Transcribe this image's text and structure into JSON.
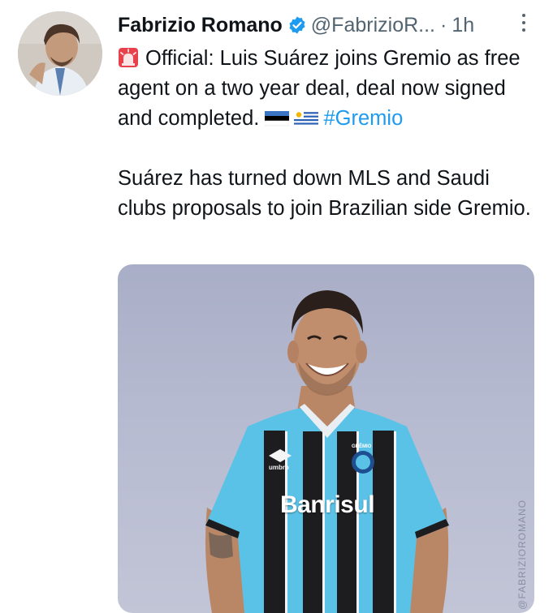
{
  "tweet": {
    "author_name": "Fabrizio Romano",
    "handle": "@FabrizioR...",
    "separator": "·",
    "time": "1h",
    "line1_text": "Official: Luis Suárez joins Gremio as free agent on a two year deal, deal now signed and completed.",
    "hashtag": "#Gremio",
    "line2_text": "Suárez has turned down MLS and Saudi clubs proposals to join Brazilian side Gremio."
  },
  "media": {
    "shirt_sponsor": "Banrisul",
    "watermark": "@FABRIZIOROMANO",
    "kit_brand": "umbro",
    "crest_text": "GRÊMIO"
  },
  "icons": {
    "verified": "verified-badge-icon",
    "more": "more-options-icon",
    "siren": "rotating-light-emoji",
    "flag1": "estonia-flag-emoji",
    "flag2": "uruguay-flag-emoji"
  },
  "colors": {
    "link": "#1d9bf0",
    "muted": "#536471",
    "text": "#0f1419",
    "verified": "#1d9bf0",
    "kit_sky_blue": "#5bc2e7",
    "kit_black": "#1d1d1f"
  }
}
